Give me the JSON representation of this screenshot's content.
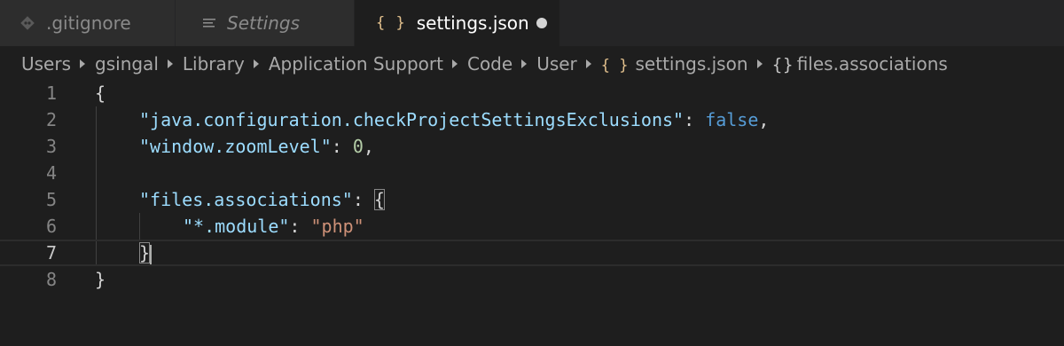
{
  "tabs": [
    {
      "label": ".gitignore",
      "icon": "git-diamond-icon",
      "italic": false,
      "active": false
    },
    {
      "label": "Settings",
      "icon": "settings-lines-icon",
      "italic": true,
      "active": false
    },
    {
      "label": "settings.json",
      "icon": "json-braces-icon",
      "italic": false,
      "active": true,
      "dirty": true
    }
  ],
  "tab_icons": {
    "json_braces": "{ }"
  },
  "breadcrumb": {
    "items": [
      "Users",
      "gsingal",
      "Library",
      "Application Support",
      "Code",
      "User"
    ],
    "file": "settings.json",
    "file_icon": "{ }",
    "symbol": "files.associations",
    "symbol_icon": "{}"
  },
  "editor": {
    "current_line": 7,
    "line_numbers": [
      "1",
      "2",
      "3",
      "4",
      "5",
      "6",
      "7",
      "8"
    ],
    "lines": {
      "l1": {
        "open": "{"
      },
      "l2": {
        "key": "\"java.configuration.checkProjectSettingsExclusions\"",
        "colon": ": ",
        "value": "false",
        "comma": ","
      },
      "l3": {
        "key": "\"window.zoomLevel\"",
        "colon": ": ",
        "value": "0",
        "comma": ","
      },
      "l5": {
        "key": "\"files.associations\"",
        "colon": ": ",
        "open": "{"
      },
      "l6": {
        "key": "\"*.module\"",
        "colon": ": ",
        "value": "\"php\""
      },
      "l7": {
        "close": "}"
      },
      "l8": {
        "close": "}"
      }
    }
  },
  "colors": {
    "background": "#1e1e1e",
    "tab_bar": "#252526",
    "json_key": "#9cdcfe",
    "json_string": "#ce9178",
    "json_keyword": "#569cd6",
    "json_number": "#b5cea8",
    "braces_icon": "#e2c08d"
  }
}
